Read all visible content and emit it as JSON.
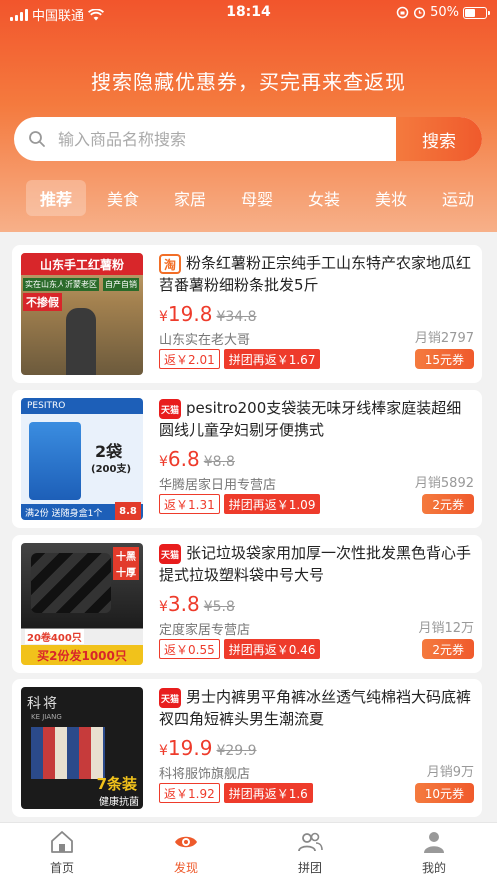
{
  "status": {
    "carrier": "中国联通",
    "time": "18:14",
    "battery": "50%"
  },
  "hero": {
    "title": "搜索隐藏优惠券，买完再来查返现"
  },
  "search": {
    "placeholder": "输入商品名称搜索",
    "button": "搜索"
  },
  "tabs": [
    {
      "label": "推荐",
      "active": true
    },
    {
      "label": "美食"
    },
    {
      "label": "家居"
    },
    {
      "label": "母婴"
    },
    {
      "label": "女装"
    },
    {
      "label": "美妆"
    },
    {
      "label": "运动"
    }
  ],
  "products": [
    {
      "platform": "淘",
      "platform_icon": "taobao-icon",
      "title": "粉条红薯粉正宗纯手工山东特产农家地瓜红苕番薯粉细粉条批发5斤",
      "price": "19.8",
      "currency": "¥",
      "original": "¥34.8",
      "shop": "山东实在老大哥",
      "sales": "月销2797",
      "rebate": "返￥2.01",
      "group": "拼团再返￥1.67",
      "coupon": "15元券",
      "thumb_text": [
        "山东手工红薯粉",
        "实在山东人",
        "沂蒙老区",
        "自产自销",
        "不掺假"
      ]
    },
    {
      "platform": "天猫",
      "platform_icon": "tmall-icon",
      "title": "pesitro200支袋装无味牙线棒家庭装超细圆线儿童孕妇剔牙便携式",
      "price": "6.8",
      "currency": "¥",
      "original": "¥8.8",
      "shop": "华腾居家日用专营店",
      "sales": "月销5892",
      "rebate": "返￥1.31",
      "group": "拼团再返￥1.09",
      "coupon": "2元券",
      "thumb_text": [
        "PESITRO",
        "2袋",
        "(200支)",
        "满2份 送随身盒1个",
        "8.8"
      ]
    },
    {
      "platform": "天猫",
      "platform_icon": "tmall-icon",
      "title": "张记垃圾袋家用加厚一次性批发黑色背心手提式拉圾塑料袋中号大号",
      "price": "3.8",
      "currency": "¥",
      "original": "¥5.8",
      "shop": "定度家居专营店",
      "sales": "月销12万",
      "rebate": "返￥0.55",
      "group": "拼团再返￥0.46",
      "coupon": "2元券",
      "thumb_text": [
        "十黑",
        "十厚",
        "20卷400只",
        "买2份发1000只"
      ]
    },
    {
      "platform": "天猫",
      "platform_icon": "tmall-icon",
      "title": "男士内裤男平角裤冰丝透气纯棉裆大码底裤衩四角短裤头男生潮流夏",
      "price": "19.9",
      "currency": "¥",
      "original": "¥29.9",
      "shop": "科将服饰旗舰店",
      "sales": "月销9万",
      "rebate": "返￥1.92",
      "group": "拼团再返￥1.6",
      "coupon": "10元券",
      "thumb_text": [
        "科将",
        "KE JIANG",
        "7条装",
        "健康抗菌"
      ]
    }
  ],
  "tabbar": [
    {
      "label": "首页",
      "icon": "home-icon"
    },
    {
      "label": "发现",
      "icon": "eye-icon",
      "active": true
    },
    {
      "label": "拼团",
      "icon": "group-icon"
    },
    {
      "label": "我的",
      "icon": "user-icon"
    }
  ],
  "colors": {
    "brand": "#f05a2c",
    "price": "#ee3b2b",
    "tmall": "#e81d1d"
  }
}
